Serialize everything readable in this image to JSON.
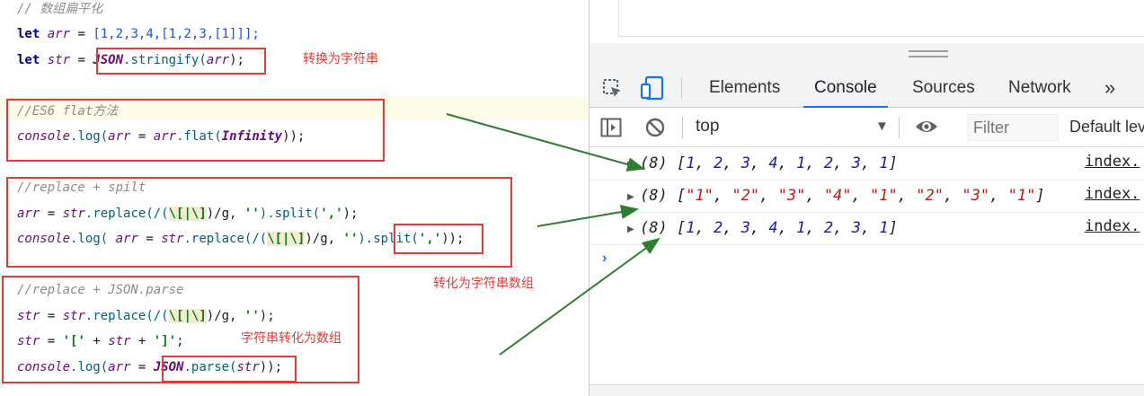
{
  "editor": {
    "line1": {
      "comment": "// 数组扁平化"
    },
    "line2": {
      "kw": "let",
      "var": "arr",
      "eq": " = ",
      "value": "[1,2,3,4,[1,2,3,[1]]];"
    },
    "line3": {
      "kw": "let",
      "var": "str",
      "eq": " = ",
      "obj": "JSON",
      "method": ".stringify(",
      "arg": "arr",
      "end": ");"
    },
    "line4": {
      "comment": "//ES6 flat方法"
    },
    "line5": {
      "obj": "console",
      "method": ".log(",
      "var1": "arr",
      "eq": " = ",
      "var2": "arr",
      "fn": ".flat(",
      "arg": "Infinity",
      "end": "));"
    },
    "line6": {
      "comment": "//replace + spilt"
    },
    "line7": {
      "var1": "arr",
      "eq": " = ",
      "var2": "str",
      "fn": ".replace(/(",
      "regex": "\\[|\\]",
      "rest": ")/g, ",
      "strval": "''",
      "split": ").split(",
      "sep": "','",
      "end": ");"
    },
    "line8": {
      "obj": "console",
      "fn": ".log( ",
      "var1": "arr",
      "eq": " = ",
      "var2": "str",
      "fn2": ".replace(/(",
      "regex": "\\[|\\]",
      "rest": ")/g, ",
      "strval": "''",
      "split": ").split(",
      "sep": "','",
      "end": "));"
    },
    "line9": {
      "comment": "//replace + JSON.parse"
    },
    "line10": {
      "var1": "str",
      "eq": " = ",
      "var2": "str",
      "fn": ".replace(/(",
      "regex": "\\[|\\]",
      "rest": ")/g, ",
      "strval": "''",
      "end": ");"
    },
    "line11": {
      "var1": "str",
      "eq": " = ",
      "s1": "'['",
      "plus1": " + ",
      "var2": "str",
      "plus2": " + ",
      "s2": "']'",
      "end": ";"
    },
    "line12": {
      "obj": "console",
      "fn": ".log(",
      "var1": "arr",
      "eq": " = ",
      "obj2": "JSON",
      "parse": ".parse(",
      "arg": "str",
      "end": "));"
    }
  },
  "annotations": {
    "a1": "转换为字符串",
    "a2": "转化为字符串数组",
    "a3": "字符串转化为数组"
  },
  "devtools": {
    "tabs": [
      "Elements",
      "Console",
      "Sources",
      "Network"
    ],
    "more_tabs": "»",
    "active_tab": "Console",
    "context": "top",
    "filter_placeholder": "Filter",
    "levels": "Default levels",
    "logs": [
      {
        "count": "(8)",
        "items": [
          "1",
          "2",
          "3",
          "4",
          "1",
          "2",
          "3",
          "1"
        ],
        "kind": "number",
        "source": "index."
      },
      {
        "count": "(8)",
        "items": [
          "\"1\"",
          "\"2\"",
          "\"3\"",
          "\"4\"",
          "\"1\"",
          "\"2\"",
          "\"3\"",
          "\"1\""
        ],
        "kind": "string",
        "source": "index."
      },
      {
        "count": "(8)",
        "items": [
          "1",
          "2",
          "3",
          "4",
          "1",
          "2",
          "3",
          "1"
        ],
        "kind": "number",
        "source": "index."
      }
    ],
    "prompt": "›"
  },
  "colors": {
    "accent": "#1a73e8",
    "annotation_red": "#e53935",
    "arrow_green": "#2e7d32"
  }
}
